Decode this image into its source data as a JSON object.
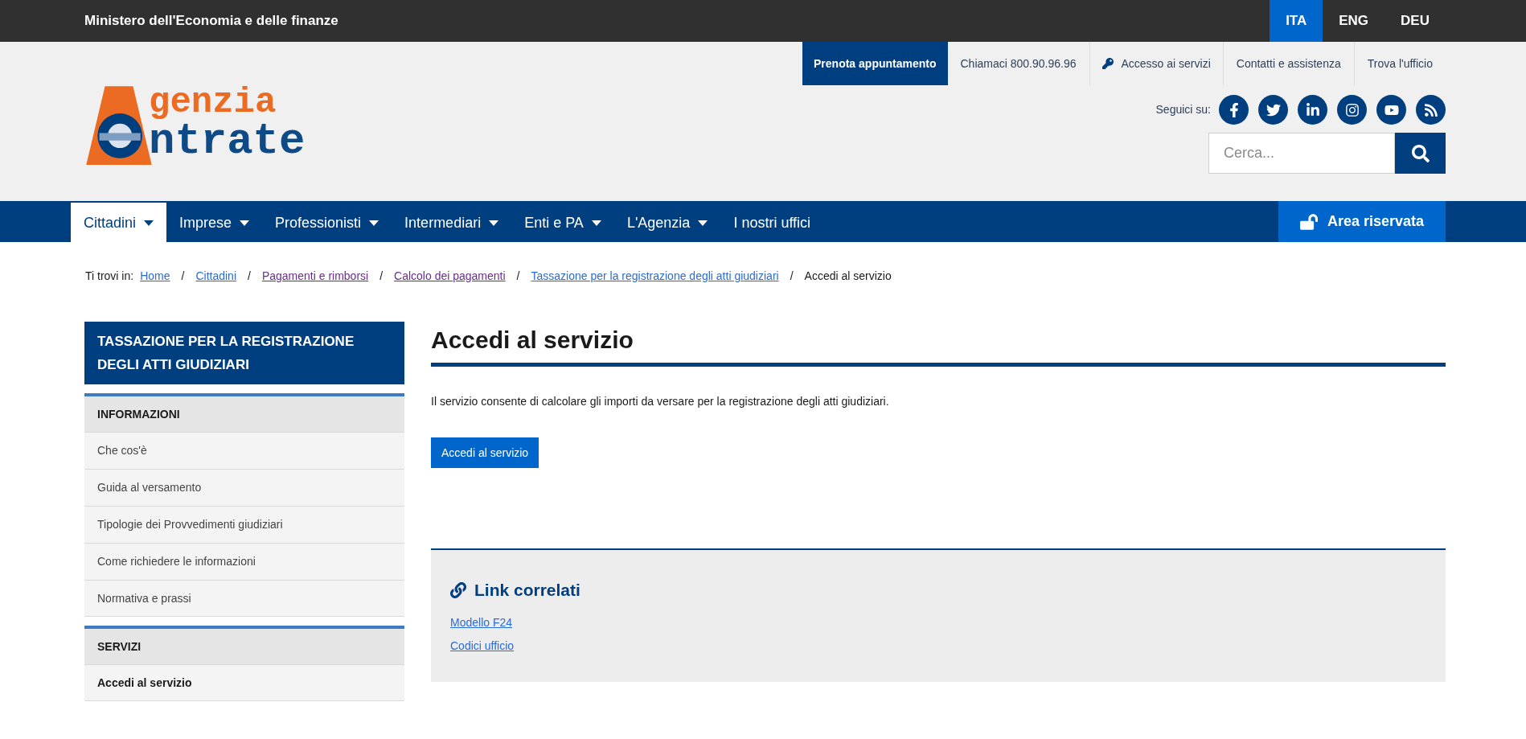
{
  "top_bar": {
    "title": "Ministero dell'Economia e delle finanze",
    "languages": [
      {
        "label": "ITA",
        "selected": true
      },
      {
        "label": "ENG",
        "selected": false
      },
      {
        "label": "DEU",
        "selected": false
      }
    ]
  },
  "utility_links": [
    {
      "label": "Prenota appuntamento",
      "kind": "primary"
    },
    {
      "label": "Chiamaci 800.90.96.96",
      "kind": "plain"
    },
    {
      "label": "Accesso ai servizi",
      "kind": "key"
    },
    {
      "label": "Contatti e assistenza",
      "kind": "plain"
    },
    {
      "label": "Trova l'ufficio",
      "kind": "plain"
    }
  ],
  "logo": {
    "line_1": "genzia",
    "line_2": "ntrate"
  },
  "social": {
    "label": "Seguici su:"
  },
  "search": {
    "placeholder": "Cerca..."
  },
  "nav": {
    "items": [
      {
        "label": "Cittadini",
        "dropdown": true,
        "selected": true
      },
      {
        "label": "Imprese",
        "dropdown": true,
        "selected": false
      },
      {
        "label": "Professionisti",
        "dropdown": true,
        "selected": false
      },
      {
        "label": "Intermediari",
        "dropdown": true,
        "selected": false
      },
      {
        "label": "Enti e PA",
        "dropdown": true,
        "selected": false
      },
      {
        "label": "L'Agenzia",
        "dropdown": true,
        "selected": false
      },
      {
        "label": "I nostri uffici",
        "dropdown": false,
        "selected": false
      }
    ],
    "reserved": "Area riservata"
  },
  "breadcrumb": {
    "label": "Ti trovi in:",
    "links": [
      {
        "label": "Home",
        "visited": false
      },
      {
        "label": "Cittadini",
        "visited": false
      },
      {
        "label": "Pagamenti e rimborsi",
        "visited": true
      },
      {
        "label": "Calcolo dei pagamenti",
        "visited": true
      },
      {
        "label": "Tassazione per la registrazione degli atti giudiziari",
        "visited": false
      }
    ],
    "separator": "/",
    "current": "Accedi al servizio"
  },
  "sidebar": {
    "title": "TASSAZIONE PER LA REGISTRAZIONE DEGLI ATTI GIUDIZIARI",
    "sections": [
      {
        "heading": "INFORMAZIONI",
        "items": [
          {
            "label": "Che cos'è",
            "selected": false
          },
          {
            "label": "Guida al versamento",
            "selected": false
          },
          {
            "label": "Tipologie dei Provvedimenti giudiziari",
            "selected": false
          },
          {
            "label": "Come richiedere le informazioni",
            "selected": false
          },
          {
            "label": "Normativa e prassi",
            "selected": false
          }
        ]
      },
      {
        "heading": "SERVIZI",
        "items": [
          {
            "label": "Accedi al servizio",
            "selected": true
          }
        ]
      }
    ]
  },
  "main": {
    "title": "Accedi al servizio",
    "text": "Il servizio consente di calcolare gli importi da versare per la registrazione degli atti giudiziari.",
    "button": "Accedi al servizio"
  },
  "related": {
    "title": "Link correlati",
    "links": [
      "Modello F24",
      "Codici ufficio"
    ]
  }
}
